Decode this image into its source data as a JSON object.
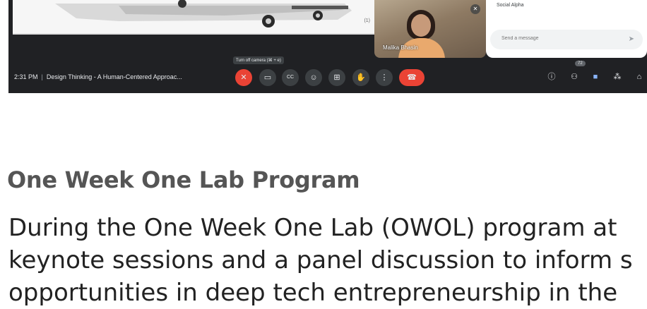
{
  "meet": {
    "presentation": {
      "slide_number": "(1)"
    },
    "participant_tile": {
      "name": "Malika Bhasin",
      "mic_icon": "mic-off-icon"
    },
    "chat": {
      "sender": "Social Alpha",
      "input_placeholder": "Send a message",
      "send_icon": "send-icon"
    },
    "bottom_bar": {
      "time": "2:31 PM",
      "separator": "|",
      "meeting_title": "Design Thinking - A Human-Centered Approac...",
      "tooltip": "Turn off camera (⌘ + e)",
      "controls": [
        {
          "name": "mic-off-icon",
          "glyph": "🎙"
        },
        {
          "name": "camera-icon",
          "glyph": "▭"
        },
        {
          "name": "captions-icon",
          "glyph": "CC"
        },
        {
          "name": "emoji-icon",
          "glyph": "☺"
        },
        {
          "name": "present-icon",
          "glyph": "⊞"
        },
        {
          "name": "raise-hand-icon",
          "glyph": "✋"
        },
        {
          "name": "more-options-icon",
          "glyph": "⋮"
        },
        {
          "name": "end-call-icon",
          "glyph": "☎"
        }
      ],
      "participant_count": "72",
      "right_icons": [
        {
          "name": "info-icon",
          "glyph": "ⓘ"
        },
        {
          "name": "people-icon",
          "glyph": "👥"
        },
        {
          "name": "chat-icon",
          "glyph": "▪"
        },
        {
          "name": "activities-icon",
          "glyph": "⁂"
        },
        {
          "name": "lock-icon",
          "glyph": "🔒"
        }
      ]
    },
    "colors": {
      "bar_background": "#202124",
      "end_call_red": "#ea4335",
      "chat_active_blue": "#8ab4f8"
    }
  },
  "article": {
    "heading": "One Week One Lab Program",
    "lines": [
      "During the One Week One Lab (OWOL) program at",
      "keynote sessions and a panel discussion to inform s",
      "opportunities in deep tech entrepreneurship in the"
    ]
  }
}
